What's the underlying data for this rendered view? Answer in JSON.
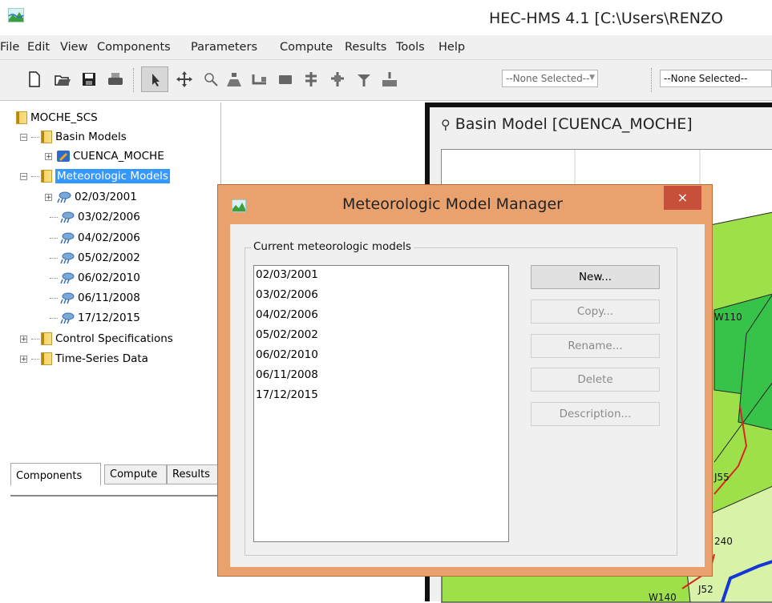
{
  "app": {
    "title": "HEC-HMS 4.1 [C:\\Users\\RENZO",
    "icon": "hec-hms-app-icon"
  },
  "menu": [
    "File",
    "Edit",
    "View",
    "Components",
    "Parameters",
    "Compute",
    "Results",
    "Tools",
    "Help"
  ],
  "toolbar": {
    "combo1": "--None Selected--",
    "combo2": "--None Selected--"
  },
  "tree": {
    "root": "MOCHE_SCS",
    "basin_models": "Basin Models",
    "basin_child": "CUENCA_MOCHE",
    "met_models": "Meteorologic Models",
    "met_children": [
      "02/03/2001",
      "03/02/2006",
      "04/02/2006",
      "05/02/2002",
      "06/02/2010",
      "06/11/2008",
      "17/12/2015"
    ],
    "control_specs": "Control Specifications",
    "time_series": "Time-Series Data"
  },
  "tabs": [
    "Components",
    "Compute",
    "Results"
  ],
  "basin_window": {
    "title": "Basin Model [CUENCA_MOCHE]",
    "map_labels": [
      "W110",
      "J55",
      "240",
      "W140",
      "J52"
    ]
  },
  "dialog": {
    "title": "Meteorologic Model Manager",
    "close": "×",
    "group_label": "Current meteorologic models",
    "models": [
      "02/03/2001",
      "03/02/2006",
      "04/02/2006",
      "05/02/2002",
      "06/02/2010",
      "06/11/2008",
      "17/12/2015"
    ],
    "buttons": {
      "new": "New...",
      "copy": "Copy...",
      "rename": "Rename...",
      "delete": "Delete",
      "description": "Description..."
    }
  },
  "colors": {
    "dialog_frame": "#e9a26d",
    "close_button": "#c7503a",
    "selection": "#3399ff",
    "map_green": "#9ee04a"
  }
}
